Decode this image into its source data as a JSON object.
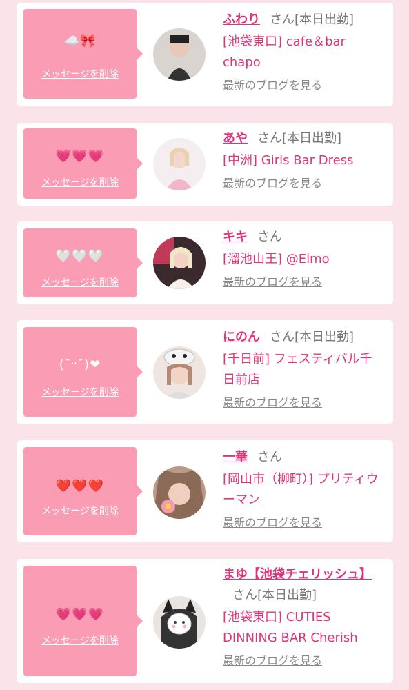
{
  "colors": {
    "accent": "#e0347a",
    "bubble": "#fb9cb5",
    "background": "#fbe3ea"
  },
  "items": [
    {
      "emoji": "☁️🎀",
      "delete": "メッセージを削除",
      "name": "ふわり",
      "san": "さん",
      "status": "[本日出勤]",
      "shop": "[池袋東口] cafe＆bar chapo",
      "blog": "最新のブログを見る"
    },
    {
      "emoji": "💗💗💗",
      "delete": "メッセージを削除",
      "name": "あや",
      "san": "さん",
      "status": "[本日出勤]",
      "shop": "[中洲] Girls Bar Dress",
      "blog": "最新のブログを見る"
    },
    {
      "emoji": "🤍🤍🤍",
      "delete": "メッセージを削除",
      "name": "キキ",
      "san": "さん",
      "status": "",
      "shop": "[溜池山王] @Elmo",
      "blog": "最新のブログを見る"
    },
    {
      "emoji": "(˘ᵕ˘)❤",
      "delete": "メッセージを削除",
      "name": "にのん",
      "san": "さん",
      "status": "[本日出勤]",
      "shop": "[千日前] フェスティバル千日前店",
      "blog": "最新のブログを見る"
    },
    {
      "emoji": "❤️❤️❤️",
      "delete": "メッセージを削除",
      "name": "一華",
      "san": "さん",
      "status": "",
      "shop": "[岡山市（柳町）] プリティウーマン",
      "blog": "最新のブログを見る"
    },
    {
      "emoji": "💗💗💗",
      "delete": "メッセージを削除",
      "name": "まゆ【池袋チェリッシュ】",
      "san": "さん",
      "status": "[本日出勤]",
      "shop": "[池袋東口] CUTIES DINNING BAR Cherish",
      "blog": "最新のブログを見る"
    }
  ]
}
